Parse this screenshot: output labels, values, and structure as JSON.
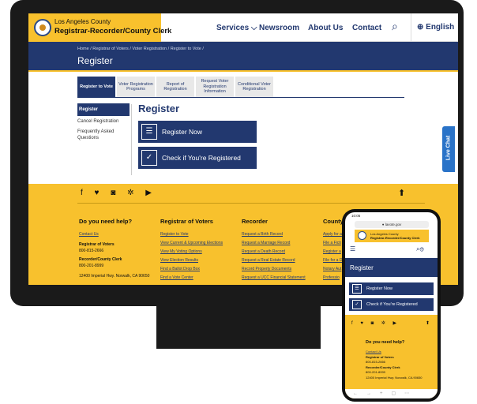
{
  "brand": {
    "county": "Los Angeles County",
    "office": "Registrar-Recorder/County Clerk"
  },
  "nav": {
    "services": "Services ⌵",
    "newsroom": "Newsroom",
    "about": "About Us",
    "contact": "Contact",
    "language": "⊕ English"
  },
  "breadcrumb": "Home  /  Registrar of Voters  /  Voter Registration  /  Register to Vote  /",
  "page_title": "Register",
  "tabs": [
    "Register to Vote",
    "Voter Registration Programs",
    "Report of Registration",
    "Request Voter Registration Information",
    "Conditional Voter Registration"
  ],
  "sidebar": {
    "items": [
      "Register",
      "Cancel Registration",
      "Frequently Asked Questions"
    ]
  },
  "main": {
    "title": "Register",
    "register_now": "Register Now",
    "check_registered": "Check if You're Registered"
  },
  "live_chat": "Live Chat",
  "footer": {
    "help": {
      "title": "Do you need help?",
      "contact": "Contact Us",
      "rov_label": "Registrar of Voters",
      "rov_phone": "800-815-2666",
      "rr_label": "Recorder/County Clerk",
      "rr_phone": "800-201-8999",
      "address": "12400 Imperial Hwy. Norwalk, CA 90650"
    },
    "voters": {
      "title": "Registrar of Voters",
      "links": [
        "Register to Vote",
        "View Current & Upcoming Elections",
        "View My Voting Options",
        "View Election Results",
        "Find a Ballot Drop Box",
        "Find a Vote Center"
      ]
    },
    "recorder": {
      "title": "Recorder",
      "links": [
        "Request a Birth Record",
        "Request a Marriage Record",
        "Request a Death Record",
        "Request a Real Estate Record",
        "Record Property Documents",
        "Request a UCC Financial Statement"
      ]
    },
    "county": {
      "title": "County",
      "links": [
        "Apply for a",
        "File a Ficti",
        "Register a",
        "File for a D",
        "Notary Aut",
        "Professio"
      ]
    }
  },
  "phone": {
    "time": "10:05",
    "url": "● lavote.gov",
    "county": "Los Angeles County",
    "office": "Registrar-Recorder/County Clerk",
    "title": "Register",
    "register_now": "Register Now",
    "check_registered": "Check if You're Registered",
    "help_title": "Do you need help?",
    "contact": "Contact Us",
    "rov_label": "Registrar of Voters",
    "rov_phone": "800-815-2666",
    "rr_label": "Recorder/County Clerk",
    "rr_phone": "800-201-8999",
    "address": "12400 Imperial Hwy. Norwalk, CA 90650"
  }
}
